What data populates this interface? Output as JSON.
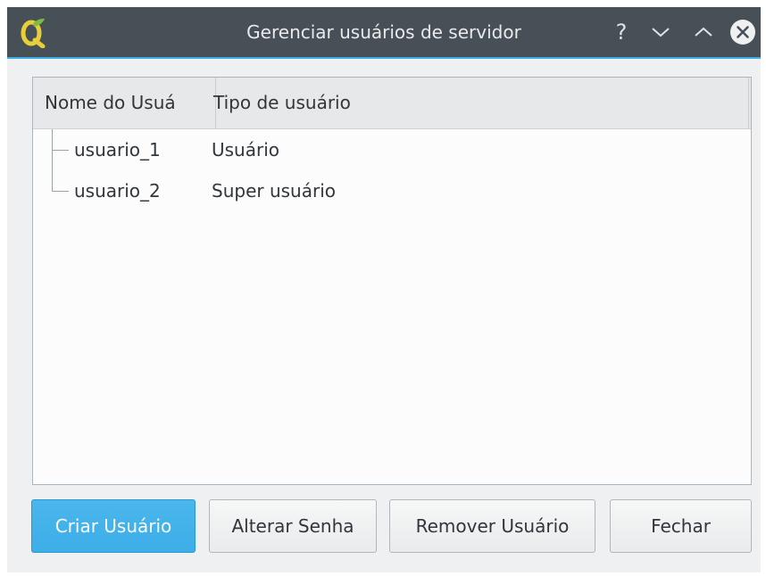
{
  "window": {
    "title": "Gerenciar usuários de servidor",
    "app_icon": "qgis-icon",
    "controls": {
      "help_label": "?",
      "minimize_icon": "chevron-down-icon",
      "maximize_icon": "chevron-up-icon",
      "close_icon": "close-icon"
    }
  },
  "tree": {
    "columns": [
      "Nome do Usuá",
      "Tipo de usuário"
    ],
    "rows": [
      {
        "name": "usuario_1",
        "type": "Usuário"
      },
      {
        "name": "usuario_2",
        "type": "Super usuário"
      }
    ]
  },
  "buttons": {
    "create": "Criar Usuário",
    "change_password": "Alterar Senha",
    "remove": "Remover Usuário",
    "close": "Fechar"
  },
  "colors": {
    "titlebar": "#475057",
    "accent": "#3daee9",
    "window_bg": "#eff0f1",
    "text": "#31363b"
  }
}
